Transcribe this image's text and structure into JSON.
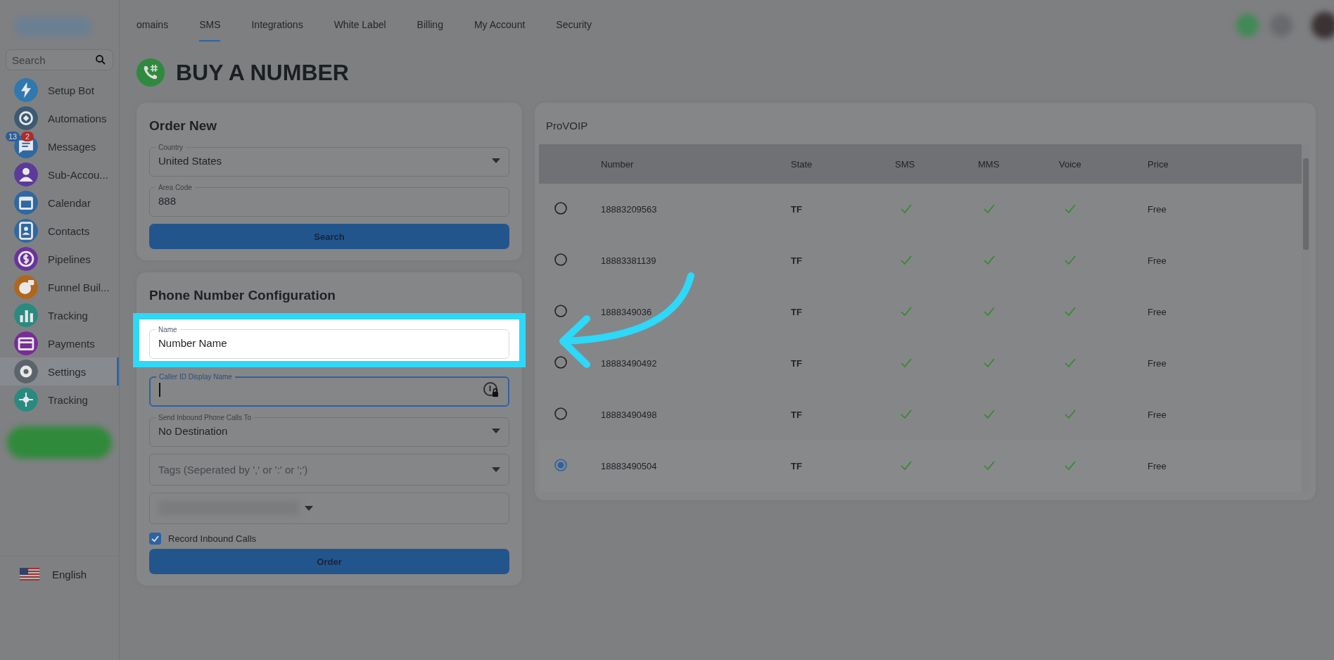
{
  "sidebar": {
    "search": {
      "placeholder": "Search"
    },
    "items": [
      {
        "label": "Setup Bot",
        "color": "#2f78b0",
        "selected": false
      },
      {
        "label": "Automations",
        "color": "#3c5a74",
        "selected": false
      },
      {
        "label": "Messages",
        "color": "#2f68a2",
        "selected": false,
        "badges": [
          {
            "text": "13",
            "color": "#2c5d98"
          },
          {
            "text": "2",
            "color": "#b02a2a"
          }
        ]
      },
      {
        "label": "Sub-Accou...",
        "color": "#5c3a9c",
        "selected": false
      },
      {
        "label": "Calendar",
        "color": "#2f68a2",
        "selected": false
      },
      {
        "label": "Contacts",
        "color": "#2f68a2",
        "selected": false
      },
      {
        "label": "Pipelines",
        "color": "#6a339c",
        "selected": false
      },
      {
        "label": "Funnel Buil...",
        "color": "#b0661c",
        "selected": false
      },
      {
        "label": "Tracking",
        "color": "#2a8a80",
        "selected": false
      },
      {
        "label": "Payments",
        "color": "#782c98",
        "selected": false
      },
      {
        "label": "Settings",
        "color": "#5c646b",
        "selected": true
      },
      {
        "label": "Tracking",
        "color": "#2a8a80",
        "selected": false
      }
    ],
    "language": "English"
  },
  "tabs": [
    {
      "label": "omains",
      "selected": false
    },
    {
      "label": "SMS",
      "selected": true
    },
    {
      "label": "Integrations",
      "selected": false
    },
    {
      "label": "White Label",
      "selected": false
    },
    {
      "label": "Billing",
      "selected": false
    },
    {
      "label": "My Account",
      "selected": false
    },
    {
      "label": "Security",
      "selected": false
    }
  ],
  "page_title": "BUY A NUMBER",
  "order_new": {
    "title": "Order New",
    "fields": [
      {
        "kind": "select",
        "label": "Country",
        "value": "United States"
      },
      {
        "kind": "text",
        "label": "Area Code",
        "value": "888"
      }
    ],
    "button": "Search"
  },
  "configuration": {
    "title": "Phone Number Configuration",
    "fields": [
      {
        "kind": "text",
        "label": "Name",
        "value": "Number Name",
        "highlighted": true
      },
      {
        "kind": "text",
        "label": "Caller ID Display Name",
        "focused": true
      },
      {
        "kind": "select",
        "label": "Send Inbound Phone Calls To",
        "value": "No Destination"
      },
      {
        "kind": "select",
        "placeholder": "Tags (Seperated by ',' or ':' or ';')"
      },
      {
        "kind": "redacted"
      }
    ],
    "checkbox": {
      "label": "Record Inbound Calls",
      "checked": true
    },
    "button": "Order"
  },
  "numbers": {
    "title": "ProVOIP",
    "columns": [
      "Number",
      "State",
      "SMS",
      "MMS",
      "Voice",
      "Price"
    ],
    "rows": [
      {
        "number": "18883209563",
        "state": "TF",
        "sms": true,
        "mms": true,
        "voice": true,
        "price": "Free",
        "selected": false
      },
      {
        "number": "18883381139",
        "state": "TF",
        "sms": true,
        "mms": true,
        "voice": true,
        "price": "Free",
        "selected": false
      },
      {
        "number": "1888349036",
        "state": "TF",
        "sms": true,
        "mms": true,
        "voice": true,
        "price": "Free",
        "selected": false
      },
      {
        "number": "18883490492",
        "state": "TF",
        "sms": true,
        "mms": true,
        "voice": true,
        "price": "Free",
        "selected": false
      },
      {
        "number": "18883490498",
        "state": "TF",
        "sms": true,
        "mms": true,
        "voice": true,
        "price": "Free",
        "selected": false
      },
      {
        "number": "18883490504",
        "state": "TF",
        "sms": true,
        "mms": true,
        "voice": true,
        "price": "Free",
        "selected": true
      }
    ]
  }
}
